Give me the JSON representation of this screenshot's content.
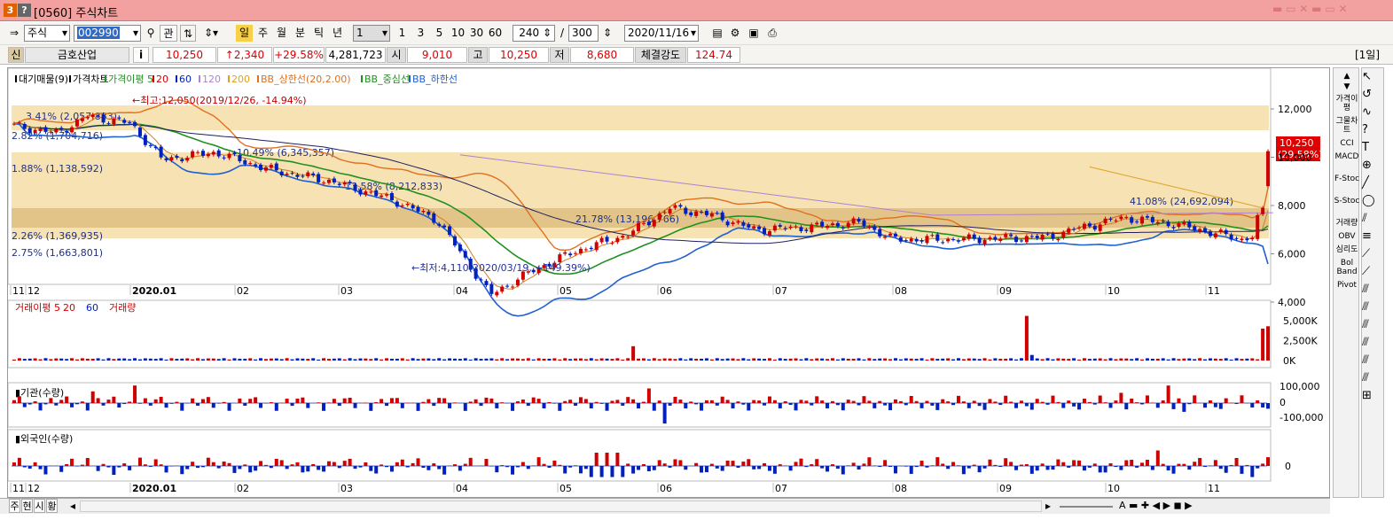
{
  "window": {
    "num_badge": "3",
    "help_badge": "?",
    "title": "[0560] 주식차트"
  },
  "toolbar": {
    "market": "주식",
    "code": "002990",
    "fav": "관",
    "periods": [
      "일",
      "주",
      "월",
      "분",
      "틱",
      "년"
    ],
    "period_select": "1",
    "intervals": [
      "1",
      "3",
      "5",
      "10",
      "30",
      "60"
    ],
    "count": "240",
    "slash": "/",
    "max_count": "300",
    "date": "2020/11/16"
  },
  "quote": {
    "badge": "신",
    "name": "금호산업",
    "info": "i",
    "price": "10,250",
    "change": "↑2,340",
    "change_pct": "+29.58%",
    "volume": "4,281,723",
    "open_label": "시",
    "open": "9,010",
    "high_label": "고",
    "high": "10,250",
    "low_label": "저",
    "low": "8,680",
    "strength_label": "체결강도",
    "strength": "124.74",
    "period_tag": "[1일]"
  },
  "price_legend": [
    "대기매물(9)",
    "가격차트",
    "가격이평 5",
    "20",
    "60",
    "120",
    "200",
    "BB_상한선(20,2.00)",
    "BB_중심선",
    "BB_하한선"
  ],
  "annotations": {
    "high": "←최고:12,050(2019/12/26, -14.94%)",
    "low": "←최저:4,110(2020/03/19, +149.39%)",
    "last_price": "10,250",
    "last_pct": "(29.58%)"
  },
  "volume_profile": [
    {
      "label": "3.41% (2,057,883)"
    },
    {
      "label": "2.82% (1,704,716)"
    },
    {
      "label": "1.88% (1,138,592)"
    },
    {
      "label": "10.49% (6,345,357)"
    },
    {
      "label": "13.58% (8,212,833)"
    },
    {
      "label": "21.78% (13,196,766)"
    },
    {
      "label": "41.08% (24,692,094)"
    },
    {
      "label": "2.26% (1,369,935)"
    },
    {
      "label": "2.75% (1,663,801)"
    }
  ],
  "x_labels": [
    "11",
    "12",
    "2020.01",
    "02",
    "03",
    "04",
    "05",
    "06",
    "07",
    "08",
    "09",
    "10",
    "11"
  ],
  "price_axis": [
    "12,000",
    "10,000",
    "8,000",
    "6,000",
    "4,000"
  ],
  "volume_legend": [
    "거래이평 5",
    "20",
    "60",
    "거래량"
  ],
  "volume_axis": [
    "5,000K",
    "2,500K",
    "0K"
  ],
  "inst_legend": "기관(수량)",
  "inst_axis": [
    "100,000",
    "0",
    "-100,000"
  ],
  "foreign_legend": "외국인(수량)",
  "foreign_axis": [
    "0"
  ],
  "right_indicators": [
    "가격이평",
    "그물차트",
    "CCI",
    "MACD",
    "F-Stoc",
    "S-Stoc",
    "거래량",
    "OBV",
    "심리도",
    "Bol Band",
    "Pivot"
  ],
  "bottom_tabs": [
    "주",
    "현",
    "시",
    "황"
  ],
  "colors": {
    "up": "#d00000",
    "down": "#0020c0",
    "bb_upper": "#e07020",
    "bb_mid": "#209020",
    "bb_lower": "#2060d0",
    "ma120": "#b080d0",
    "ma200": "#e0a020",
    "ma60": "#202060",
    "profile": "#f3d898",
    "profile_max": "#d8b060"
  }
}
